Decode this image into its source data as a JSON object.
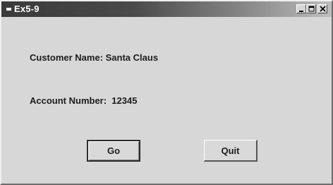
{
  "window": {
    "title": "Ex5-9",
    "icon": "app-icon",
    "controls": [
      "minimize-icon",
      "maximize-icon",
      "close-icon"
    ]
  },
  "form": {
    "customer_label": "Customer Name: Santa Claus",
    "account_label": "Account Number:  12345"
  },
  "buttons": {
    "go_label": "Go",
    "quit_label": "Quit"
  }
}
